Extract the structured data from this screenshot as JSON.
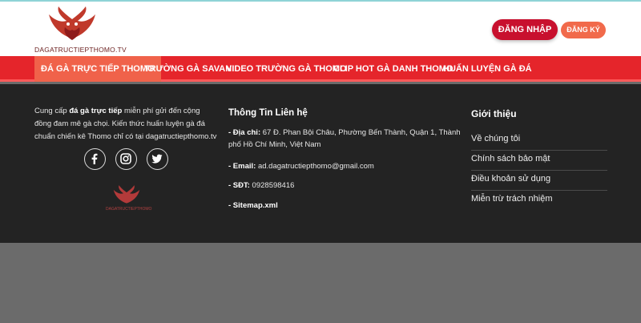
{
  "header": {
    "logo_text": "DAGATRUCTIEPTHOMO.TV",
    "login_label": "ĐĂNG NHẬP",
    "register_label": "ĐĂNG KÝ"
  },
  "nav": {
    "items": [
      {
        "label": "ĐÁ GÀ TRỰC TIẾP THOMO",
        "active": true
      },
      {
        "label": "TRƯỜNG GÀ SAVAN"
      },
      {
        "label": "VIDEO TRƯỜNG GÀ THOMO"
      },
      {
        "label": "CLIP HOT GÀ DANH THOMO"
      },
      {
        "label": "HUẤN LUYỆN GÀ ĐÁ"
      }
    ]
  },
  "footer": {
    "about": {
      "prefix": "Cung cấp ",
      "highlight": "đá gà trực tiếp",
      "suffix": " miễn phí gửi đến cộng đồng đam mê gà chọi. Kiến thức huấn luyện gà đá chuẩn chiến kê Thomo chỉ có tại dagatructiepthomo.tv"
    },
    "social": [
      "facebook-icon",
      "instagram-icon",
      "twitter-icon"
    ],
    "mini_logo_text": "DAGATRUCTIEPTHOMO",
    "contact": {
      "title": "Thông Tin Liên hệ",
      "address_label": "- Địa chỉ:",
      "address_value": " 67 Đ. Phan Bội Châu, Phường Bến Thành, Quận 1, Thành phố Hồ Chí Minh, Việt Nam",
      "email_label": "- Email:",
      "email_value": " ad.dagatructiepthomo@gmail.com",
      "phone_label": "- SĐT:",
      "phone_value": " 0928598416",
      "sitemap_label": "- Sitemap.xml"
    },
    "info": {
      "title": "Giới thiệu",
      "links": [
        "Về chúng tôi",
        "Chính sách bảo mật",
        "Điều khoản sử dụng",
        "Miễn trừ trách nhiệm"
      ]
    }
  },
  "colors": {
    "nav_bg": "#e5252b",
    "nav_active": "#f0624a",
    "login_bg": "#c8102e",
    "register_bg": "#f16a4b",
    "footer_bg": "#232323"
  }
}
